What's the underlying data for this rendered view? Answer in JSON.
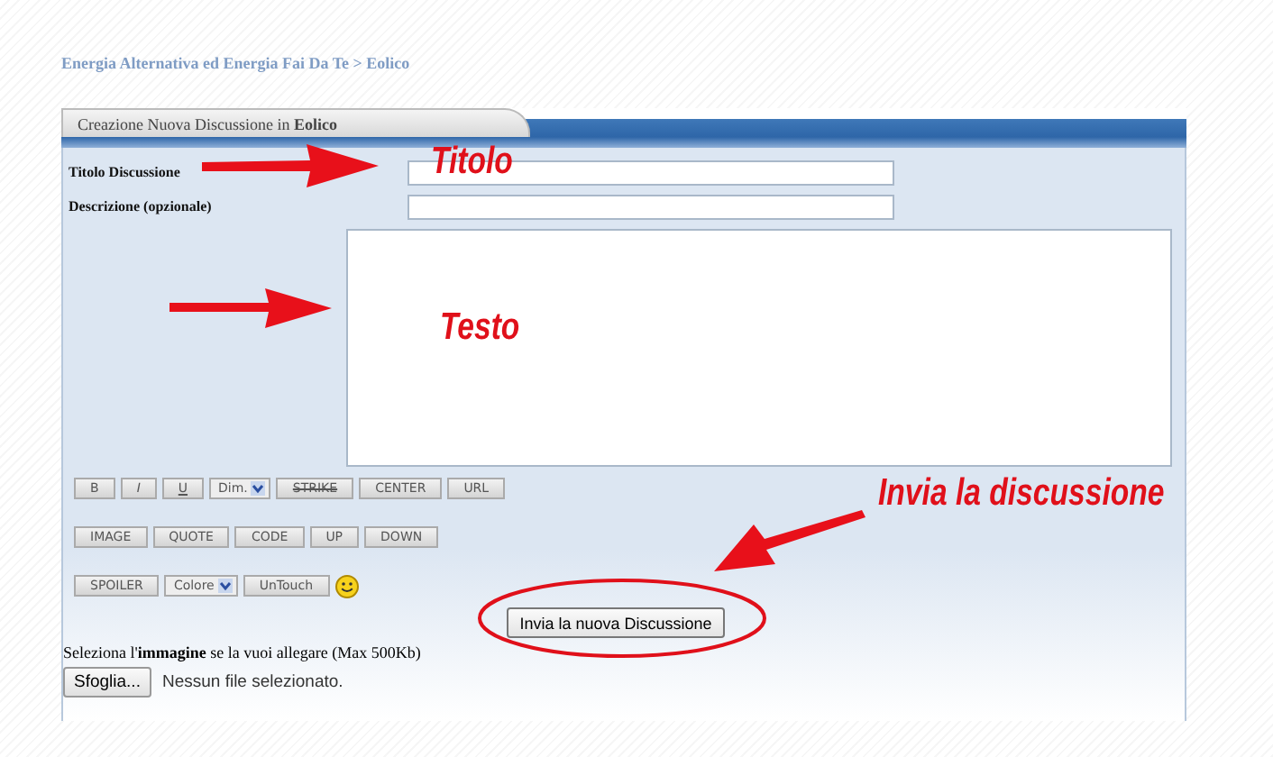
{
  "breadcrumb": "Energia Alternativa ed Energia Fai Da Te > Eolico",
  "panel": {
    "title": "Creazione Nuova Discussione in **Eolico**"
  },
  "fields": [
    {
      "label": "Titolo Discussione"
    },
    {
      "label": "Descrizione (opzionale)"
    }
  ],
  "toolbar_rows": [
    [
      {
        "kind": "button",
        "label": "B"
      },
      {
        "kind": "italic",
        "label": "I"
      },
      {
        "kind": "underline",
        "label": "U"
      },
      {
        "kind": "select",
        "label": "Dim."
      },
      {
        "kind": "strike",
        "label": "STRIKE"
      },
      {
        "kind": "button",
        "label": "CENTER"
      },
      {
        "kind": "button",
        "label": "URL"
      }
    ],
    [
      {
        "kind": "button",
        "label": "IMAGE"
      },
      {
        "kind": "button",
        "label": "QUOTE"
      },
      {
        "kind": "button",
        "label": "CODE"
      },
      {
        "kind": "button",
        "label": "UP"
      },
      {
        "kind": "button",
        "label": "DOWN"
      }
    ],
    [
      {
        "kind": "button",
        "label": "SPOILER"
      },
      {
        "kind": "select",
        "label": "Colore"
      },
      {
        "kind": "button",
        "label": "UnTouch"
      },
      {
        "kind": "emoji"
      }
    ]
  ],
  "submit": "Invia la nuova Discussione",
  "attach": {
    "label": "Seleziona l'**immagine** se la vuoi allegare (Max 500Kb)",
    "button": "Sfoglia...",
    "status": "Nessun file selezionato."
  },
  "annotations": [
    {
      "kind": "title",
      "text": "Titolo"
    },
    {
      "kind": "text",
      "text": "Testo"
    },
    {
      "kind": "submit",
      "text": "Invia la discussione"
    }
  ]
}
